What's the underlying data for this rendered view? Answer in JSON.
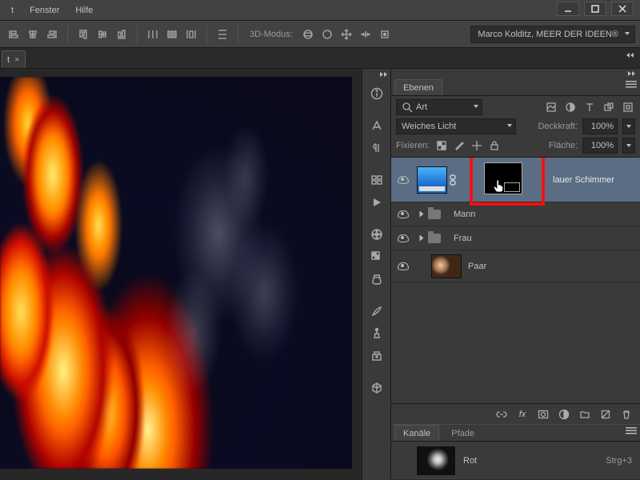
{
  "menu": {
    "items": [
      "t",
      "Fenster",
      "Hilfe"
    ]
  },
  "opt": {
    "mode_label": "3D-Modus:",
    "user_dd": "Marco Kolditz, MEER DER IDEEN®"
  },
  "doc_tab": {
    "title": "t"
  },
  "panels": {
    "layers_tab": "Ebenen",
    "filter_dd": "Art",
    "blend_dd": "Weiches Licht",
    "opacity_label": "Deckkraft:",
    "opacity_value": "100%",
    "fill_label": "Fläche:",
    "fill_value": "100%",
    "lock_label": "Fixieren:",
    "layers": {
      "blauer": "lauer Schimmer",
      "mann": "Mann",
      "frau": "Frau",
      "paar": "Paar"
    },
    "foot_fx": "fx",
    "channels_tab": "Kanäle",
    "paths_tab": "Pfade",
    "ch_rot": {
      "name": "Rot",
      "short": "Strg+3"
    }
  },
  "icons": {
    "search": "search",
    "image": "image",
    "circle-half": "circle-half",
    "type": "type",
    "shape": "shape",
    "lock": "lock",
    "link": "link",
    "fx": "fx",
    "mask": "mask",
    "adjust": "adjust",
    "folder": "folder",
    "new": "new",
    "trash": "trash"
  }
}
